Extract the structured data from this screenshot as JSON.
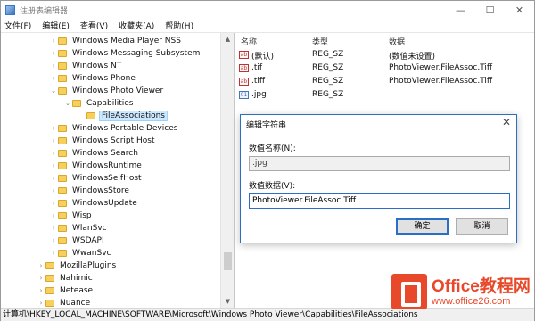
{
  "window": {
    "title": "注册表编辑器",
    "controls": [
      "—",
      "☐",
      "✕"
    ]
  },
  "menu": [
    "文件(F)",
    "编辑(E)",
    "查看(V)",
    "收藏夹(A)",
    "帮助(H)"
  ],
  "tree": [
    {
      "label": "Windows Media Player NSS",
      "level": 1,
      "exp": ">"
    },
    {
      "label": "Windows Messaging Subsystem",
      "level": 1,
      "exp": ">"
    },
    {
      "label": "Windows NT",
      "level": 1,
      "exp": ">"
    },
    {
      "label": "Windows Phone",
      "level": 1,
      "exp": ">"
    },
    {
      "label": "Windows Photo Viewer",
      "level": 1,
      "exp": "v"
    },
    {
      "label": "Capabilities",
      "level": 2,
      "exp": "v"
    },
    {
      "label": "FileAssociations",
      "level": 3,
      "exp": "",
      "selected": true
    },
    {
      "label": "Windows Portable Devices",
      "level": 1,
      "exp": ">"
    },
    {
      "label": "Windows Script Host",
      "level": 1,
      "exp": ">"
    },
    {
      "label": "Windows Search",
      "level": 1,
      "exp": ">"
    },
    {
      "label": "WindowsRuntime",
      "level": 1,
      "exp": ">"
    },
    {
      "label": "WindowsSelfHost",
      "level": 1,
      "exp": ">"
    },
    {
      "label": "WindowsStore",
      "level": 1,
      "exp": ">"
    },
    {
      "label": "WindowsUpdate",
      "level": 1,
      "exp": ">"
    },
    {
      "label": "Wisp",
      "level": 1,
      "exp": ">"
    },
    {
      "label": "WlanSvc",
      "level": 1,
      "exp": ">"
    },
    {
      "label": "WSDAPI",
      "level": 1,
      "exp": ">"
    },
    {
      "label": "WwanSvc",
      "level": 1,
      "exp": ">"
    },
    {
      "label": "MozillaPlugins",
      "level": 0,
      "exp": ">"
    },
    {
      "label": "Nahimic",
      "level": 0,
      "exp": ">"
    },
    {
      "label": "Netease",
      "level": 0,
      "exp": ">"
    },
    {
      "label": "Nuance",
      "level": 0,
      "exp": ">"
    }
  ],
  "list": {
    "headers": {
      "name": "名称",
      "type": "类型",
      "data": "数据"
    },
    "rows": [
      {
        "icon": "ab",
        "name": "(默认)",
        "type": "REG_SZ",
        "data": "(数值未设置)"
      },
      {
        "icon": "ab",
        "name": ".tif",
        "type": "REG_SZ",
        "data": "PhotoViewer.FileAssoc.Tiff"
      },
      {
        "icon": "ab",
        "name": ".tiff",
        "type": "REG_SZ",
        "data": "PhotoViewer.FileAssoc.Tiff"
      },
      {
        "icon": "bin",
        "name": ".jpg",
        "type": "REG_SZ",
        "data": ""
      }
    ]
  },
  "dialog": {
    "title": "编辑字符串",
    "name_label": "数值名称(N):",
    "name_value": ".jpg",
    "data_label": "数值数据(V):",
    "data_value": "PhotoViewer.FileAssoc.Tiff",
    "ok": "确定",
    "cancel": "取消"
  },
  "status": "计算机\\HKEY_LOCAL_MACHINE\\SOFTWARE\\Microsoft\\Windows Photo Viewer\\Capabilities\\FileAssociations",
  "watermark": {
    "brand": "Office教程网",
    "url": "www.office26.com"
  }
}
